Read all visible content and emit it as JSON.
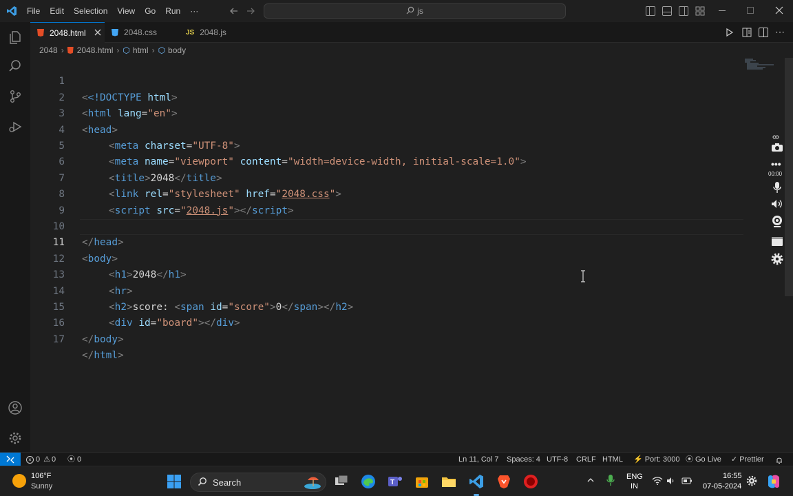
{
  "titlebar": {
    "menu": [
      "File",
      "Edit",
      "Selection",
      "View",
      "Go",
      "Run",
      "···"
    ],
    "search_text": "js"
  },
  "tabs": [
    {
      "label": "2048.html",
      "icon": "html5-icon",
      "active": true
    },
    {
      "label": "2048.css",
      "icon": "css3-icon",
      "active": false
    },
    {
      "label": "2048.js",
      "icon_text": "JS",
      "active": false
    }
  ],
  "breadcrumb": {
    "folder": "2048",
    "file": "2048.html",
    "symbol1": "html",
    "symbol2": "body"
  },
  "editor": {
    "current_line": 11,
    "lines": [
      {
        "n": "1"
      },
      {
        "n": "2"
      },
      {
        "n": "3"
      },
      {
        "n": "4"
      },
      {
        "n": "5"
      },
      {
        "n": "6"
      },
      {
        "n": "7"
      },
      {
        "n": "8"
      },
      {
        "n": "9"
      },
      {
        "n": "10"
      },
      {
        "n": "11"
      },
      {
        "n": "12"
      },
      {
        "n": "13"
      },
      {
        "n": "14"
      },
      {
        "n": "15"
      },
      {
        "n": "16"
      },
      {
        "n": "17"
      }
    ],
    "tokens": {
      "doctype_open": "<!DOCTYPE ",
      "doctype_html": "html",
      "gt": ">",
      "lt": "<",
      "lt_slash": "</",
      "html": "html",
      "lang": "lang",
      "eq": "=",
      "en": "\"en\"",
      "head": "head",
      "meta": "meta",
      "charset": "charset",
      "utf8": "\"UTF-8\"",
      "name": "name",
      "viewport": "\"viewport\"",
      "content": "content",
      "content_val": "\"width=device-width, initial-scale=1.0\"",
      "title": "title",
      "title_text": "2048",
      "link": "link",
      "rel": "rel",
      "stylesheet": "\"stylesheet\"",
      "href": "href",
      "q": "\"",
      "css_file": "2048.css",
      "script": "script",
      "src": "src",
      "js_file": "2048.js",
      "body": "body",
      "h1": "h1",
      "h1_text": "2048",
      "hr": "hr",
      "h2": "h2",
      "score_text": "score: ",
      "span": "span",
      "id": "id",
      "score_id": "\"score\"",
      "zero": "0",
      "div": "div",
      "board_id": "\"board\"",
      "space": " "
    }
  },
  "recorder": {
    "timer": "00:00"
  },
  "statusbar": {
    "errors": "0",
    "warnings": "0",
    "ports": "0",
    "position": "Ln 11, Col 7",
    "spaces": "Spaces: 4",
    "encoding": "UTF-8",
    "eol": "CRLF",
    "language": "HTML",
    "port": "Port: 3000",
    "golive": "Go Live",
    "prettier": "Prettier"
  },
  "taskbar": {
    "weather_temp": "106°F",
    "weather_desc": "Sunny",
    "search": "Search",
    "lang1": "ENG",
    "lang2": "IN",
    "time": "16:55",
    "date": "07-05-2024"
  },
  "colors": {
    "accent": "#0078d4",
    "tag": "#569cd6",
    "attr": "#9cdcfe",
    "string": "#ce9178",
    "punct": "#808080"
  }
}
